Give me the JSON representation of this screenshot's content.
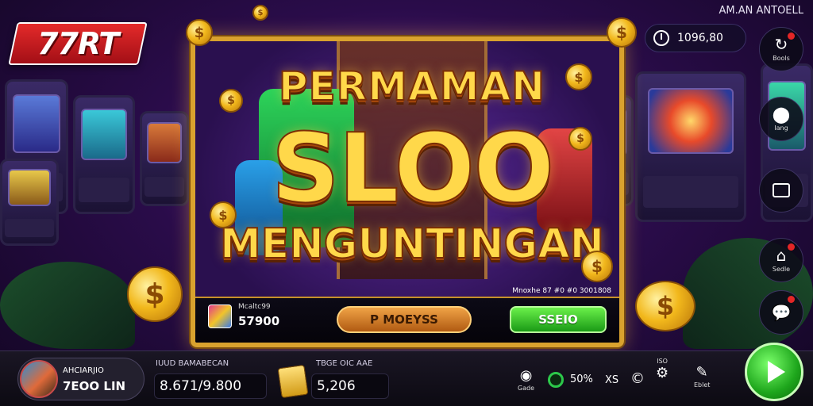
{
  "brand": {
    "logo_text": "77RT",
    "top_title": "AM.AN ANTOELL"
  },
  "header": {
    "balance": "1096,80"
  },
  "side_menu": [
    {
      "label": "Bools",
      "icon": "refresh-icon"
    },
    {
      "label": "Iang",
      "icon": "location-icon"
    },
    {
      "label": "",
      "icon": "window-icon"
    },
    {
      "label": "Sedle",
      "icon": "home-icon"
    },
    {
      "label": "",
      "icon": "chat-icon"
    }
  ],
  "game": {
    "title_line1": "PERMAMAN",
    "title_line2": "SLOO",
    "title_line3": "MENGUNTINGAN",
    "mini_game_name": "Mcaltc99",
    "mini_game_amount": "57900",
    "info_strip": "Mnoxhe 87 #0 #0 3001808",
    "bet_button": "P MOEYSS",
    "spin_button": "SSEIO"
  },
  "bottom_bar": {
    "profile_name": "AHCIARJIO",
    "profile_coins": "7EOO LIN",
    "stat1_label": "IUUD BAMABECAN",
    "stat1_value": "8.671/9.800",
    "stat2_label": "TBGE OIC AAE",
    "stat2_value": "5,206",
    "item1_label": "Gade",
    "percent": "50%",
    "item2_glyph": "XS",
    "item3_label": "ISO",
    "item4_label": "Eblet"
  },
  "colors": {
    "gold": "#ffd84a",
    "accent_red": "#e42a2a",
    "accent_green": "#1ea61c",
    "frame": "#d9a22e"
  }
}
